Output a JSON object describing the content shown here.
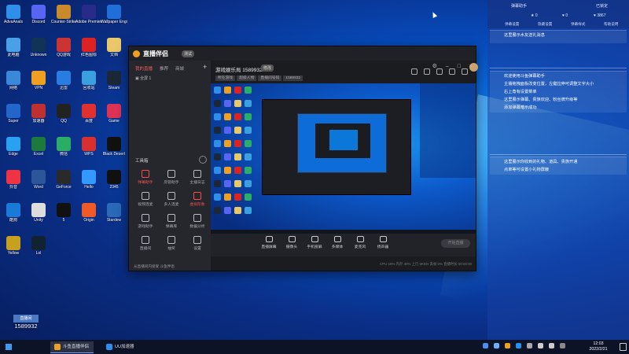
{
  "desktop_icons": [
    {
      "label": "AdvaAnals",
      "color": "#2e8ee8"
    },
    {
      "label": "Discord",
      "color": "#5865f2"
    },
    {
      "label": "Counter-Strike",
      "color": "#c88a2a"
    },
    {
      "label": "Adobe Premiere",
      "color": "#2a2a8a"
    },
    {
      "label": "Wallpaper Engine",
      "color": "#1f6fd6"
    },
    {
      "label": "此电脑",
      "color": "#4aa0e6"
    },
    {
      "label": "Unknown",
      "color": "#113355"
    },
    {
      "label": "QQ游戏",
      "color": "#cc3333"
    },
    {
      "label": "红色图标",
      "color": "#dd2222"
    },
    {
      "label": "文档",
      "color": "#e8c86a"
    },
    {
      "label": "网络",
      "color": "#3a88d8"
    },
    {
      "label": "VPN",
      "color": "#f0a020"
    },
    {
      "label": "迅雷",
      "color": "#2a7de0"
    },
    {
      "label": "回收站",
      "color": "#3aa0e0"
    },
    {
      "label": "Steam",
      "color": "#1b2838"
    },
    {
      "label": "Super",
      "color": "#2266cc"
    },
    {
      "label": "加速器",
      "color": "#c03030"
    },
    {
      "label": "QQ",
      "color": "#222222"
    },
    {
      "label": "百度",
      "color": "#e03030"
    },
    {
      "label": "Game",
      "color": "#dd3355"
    },
    {
      "label": "Edge",
      "color": "#2aa0f0"
    },
    {
      "label": "Excel",
      "color": "#1d7a3e"
    },
    {
      "label": "微信",
      "color": "#2aae67"
    },
    {
      "label": "WPS",
      "color": "#d83030"
    },
    {
      "label": "Black Desert",
      "color": "#111111"
    },
    {
      "label": "抖音",
      "color": "#ee3344"
    },
    {
      "label": "Word",
      "color": "#2b579a"
    },
    {
      "label": "GeForce",
      "color": "#2a2a2a"
    },
    {
      "label": "Hello",
      "color": "#3399ff"
    },
    {
      "label": "2345",
      "color": "#111111"
    },
    {
      "label": "酷狗",
      "color": "#1a7ad8"
    },
    {
      "label": "Unity",
      "color": "#dddddd"
    },
    {
      "label": "5",
      "color": "#111111"
    },
    {
      "label": "Origin",
      "color": "#f05a28"
    },
    {
      "label": "Stardew",
      "color": "#2a6ab8"
    },
    {
      "label": "Yellow",
      "color": "#c8a020"
    },
    {
      "label": "Lol",
      "color": "#112233"
    }
  ],
  "watermark": {
    "label": "直播间",
    "room_id": "1589932"
  },
  "window": {
    "logo_text": "直播伴侣",
    "version_badge": "测试",
    "side_tabs": [
      {
        "label": "我的直播",
        "active": true
      },
      {
        "label": "推荐",
        "active": false
      },
      {
        "label": "商城",
        "active": false
      }
    ],
    "scene_label": "全屏 1",
    "toolbox_title": "工具箱",
    "tools": [
      {
        "label": "弹幕助手",
        "red": true
      },
      {
        "label": "房管助手",
        "red": false
      },
      {
        "label": "主播日志",
        "red": false
      },
      {
        "label": "视频连麦",
        "red": false
      },
      {
        "label": "多人连麦",
        "red": false
      },
      {
        "label": "虚拟形象",
        "red": true
      },
      {
        "label": "游戏助手",
        "red": false
      },
      {
        "label": "弹幕库",
        "red": false
      },
      {
        "label": "数据分析",
        "red": false
      },
      {
        "label": "直播间",
        "red": false
      },
      {
        "label": "抽奖",
        "red": false
      },
      {
        "label": "设置",
        "red": false
      }
    ],
    "bottom_note": "从直播间内接受 斗鱼伴侣",
    "room_title": "游戏娱乐局 1589932",
    "room_badge": "修改",
    "room_info": [
      "所在游戏",
      "超级人物",
      "直播间号码",
      "1589932"
    ],
    "controls": [
      {
        "label": "直播屏幕"
      },
      {
        "label": "摄像头"
      },
      {
        "label": "手机投屏"
      },
      {
        "label": "多媒体"
      },
      {
        "label": "麦克风"
      },
      {
        "label": "扬声器"
      }
    ],
    "start_button": "开始直播",
    "stats": "CPU 18%  内存 40%  上行 0KB/s  丢帧 0%  直播时长 00:00:00"
  },
  "right_panel": {
    "title": "弹幕助手",
    "close_label": "已锁定",
    "stats": [
      {
        "label": "★ 0"
      },
      {
        "label": "♥ 0"
      },
      {
        "label": "♥ 3867"
      }
    ],
    "tabs": [
      "弹幕设置",
      "隐藏设置",
      "弹幕样式",
      "帮助说明"
    ],
    "block1": "这里展示水友送礼消息",
    "block2": [
      "欢迎使用斗鱼弹幕助手",
      "主播拖拽面板改变位置，左键拉伸可调整文字大小",
      "右上角有设置菜单",
      "这里展示弹幕、贵族欢迎、粉丝牌升级等",
      "添加弹幕暗示成功"
    ],
    "block3": [
      "这里展示你收到的礼物、道具、贵族开通",
      "点单等可设置小礼物屏蔽"
    ]
  },
  "taskbar": {
    "items": [
      {
        "label": "斗鱼直播伴侣",
        "active": true,
        "color": "#f0a020"
      },
      {
        "label": "UU加速器",
        "active": false,
        "color": "#2a90f0"
      }
    ],
    "time": "12:03",
    "date": "2022/2/21"
  }
}
